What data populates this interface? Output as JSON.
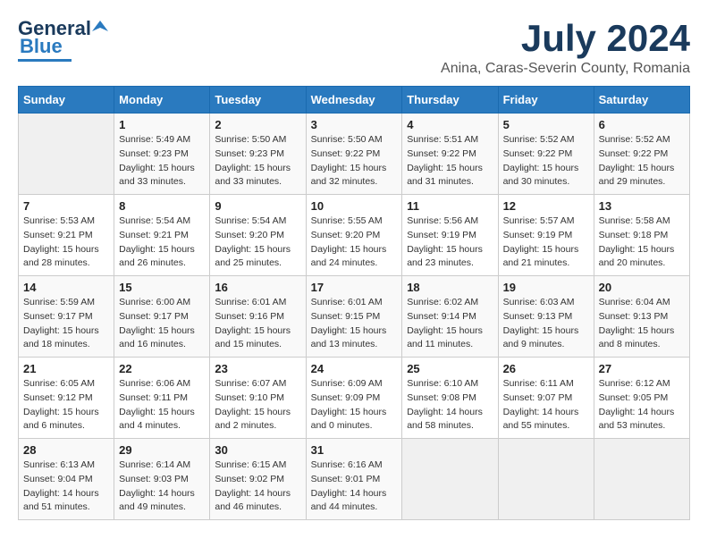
{
  "header": {
    "logo_line1": "General",
    "logo_line2": "Blue",
    "month": "July 2024",
    "location": "Anina, Caras-Severin County, Romania"
  },
  "weekdays": [
    "Sunday",
    "Monday",
    "Tuesday",
    "Wednesday",
    "Thursday",
    "Friday",
    "Saturday"
  ],
  "weeks": [
    [
      {
        "day": "",
        "info": ""
      },
      {
        "day": "1",
        "info": "Sunrise: 5:49 AM\nSunset: 9:23 PM\nDaylight: 15 hours\nand 33 minutes."
      },
      {
        "day": "2",
        "info": "Sunrise: 5:50 AM\nSunset: 9:23 PM\nDaylight: 15 hours\nand 33 minutes."
      },
      {
        "day": "3",
        "info": "Sunrise: 5:50 AM\nSunset: 9:22 PM\nDaylight: 15 hours\nand 32 minutes."
      },
      {
        "day": "4",
        "info": "Sunrise: 5:51 AM\nSunset: 9:22 PM\nDaylight: 15 hours\nand 31 minutes."
      },
      {
        "day": "5",
        "info": "Sunrise: 5:52 AM\nSunset: 9:22 PM\nDaylight: 15 hours\nand 30 minutes."
      },
      {
        "day": "6",
        "info": "Sunrise: 5:52 AM\nSunset: 9:22 PM\nDaylight: 15 hours\nand 29 minutes."
      }
    ],
    [
      {
        "day": "7",
        "info": "Sunrise: 5:53 AM\nSunset: 9:21 PM\nDaylight: 15 hours\nand 28 minutes."
      },
      {
        "day": "8",
        "info": "Sunrise: 5:54 AM\nSunset: 9:21 PM\nDaylight: 15 hours\nand 26 minutes."
      },
      {
        "day": "9",
        "info": "Sunrise: 5:54 AM\nSunset: 9:20 PM\nDaylight: 15 hours\nand 25 minutes."
      },
      {
        "day": "10",
        "info": "Sunrise: 5:55 AM\nSunset: 9:20 PM\nDaylight: 15 hours\nand 24 minutes."
      },
      {
        "day": "11",
        "info": "Sunrise: 5:56 AM\nSunset: 9:19 PM\nDaylight: 15 hours\nand 23 minutes."
      },
      {
        "day": "12",
        "info": "Sunrise: 5:57 AM\nSunset: 9:19 PM\nDaylight: 15 hours\nand 21 minutes."
      },
      {
        "day": "13",
        "info": "Sunrise: 5:58 AM\nSunset: 9:18 PM\nDaylight: 15 hours\nand 20 minutes."
      }
    ],
    [
      {
        "day": "14",
        "info": "Sunrise: 5:59 AM\nSunset: 9:17 PM\nDaylight: 15 hours\nand 18 minutes."
      },
      {
        "day": "15",
        "info": "Sunrise: 6:00 AM\nSunset: 9:17 PM\nDaylight: 15 hours\nand 16 minutes."
      },
      {
        "day": "16",
        "info": "Sunrise: 6:01 AM\nSunset: 9:16 PM\nDaylight: 15 hours\nand 15 minutes."
      },
      {
        "day": "17",
        "info": "Sunrise: 6:01 AM\nSunset: 9:15 PM\nDaylight: 15 hours\nand 13 minutes."
      },
      {
        "day": "18",
        "info": "Sunrise: 6:02 AM\nSunset: 9:14 PM\nDaylight: 15 hours\nand 11 minutes."
      },
      {
        "day": "19",
        "info": "Sunrise: 6:03 AM\nSunset: 9:13 PM\nDaylight: 15 hours\nand 9 minutes."
      },
      {
        "day": "20",
        "info": "Sunrise: 6:04 AM\nSunset: 9:13 PM\nDaylight: 15 hours\nand 8 minutes."
      }
    ],
    [
      {
        "day": "21",
        "info": "Sunrise: 6:05 AM\nSunset: 9:12 PM\nDaylight: 15 hours\nand 6 minutes."
      },
      {
        "day": "22",
        "info": "Sunrise: 6:06 AM\nSunset: 9:11 PM\nDaylight: 15 hours\nand 4 minutes."
      },
      {
        "day": "23",
        "info": "Sunrise: 6:07 AM\nSunset: 9:10 PM\nDaylight: 15 hours\nand 2 minutes."
      },
      {
        "day": "24",
        "info": "Sunrise: 6:09 AM\nSunset: 9:09 PM\nDaylight: 15 hours\nand 0 minutes."
      },
      {
        "day": "25",
        "info": "Sunrise: 6:10 AM\nSunset: 9:08 PM\nDaylight: 14 hours\nand 58 minutes."
      },
      {
        "day": "26",
        "info": "Sunrise: 6:11 AM\nSunset: 9:07 PM\nDaylight: 14 hours\nand 55 minutes."
      },
      {
        "day": "27",
        "info": "Sunrise: 6:12 AM\nSunset: 9:05 PM\nDaylight: 14 hours\nand 53 minutes."
      }
    ],
    [
      {
        "day": "28",
        "info": "Sunrise: 6:13 AM\nSunset: 9:04 PM\nDaylight: 14 hours\nand 51 minutes."
      },
      {
        "day": "29",
        "info": "Sunrise: 6:14 AM\nSunset: 9:03 PM\nDaylight: 14 hours\nand 49 minutes."
      },
      {
        "day": "30",
        "info": "Sunrise: 6:15 AM\nSunset: 9:02 PM\nDaylight: 14 hours\nand 46 minutes."
      },
      {
        "day": "31",
        "info": "Sunrise: 6:16 AM\nSunset: 9:01 PM\nDaylight: 14 hours\nand 44 minutes."
      },
      {
        "day": "",
        "info": ""
      },
      {
        "day": "",
        "info": ""
      },
      {
        "day": "",
        "info": ""
      }
    ]
  ]
}
